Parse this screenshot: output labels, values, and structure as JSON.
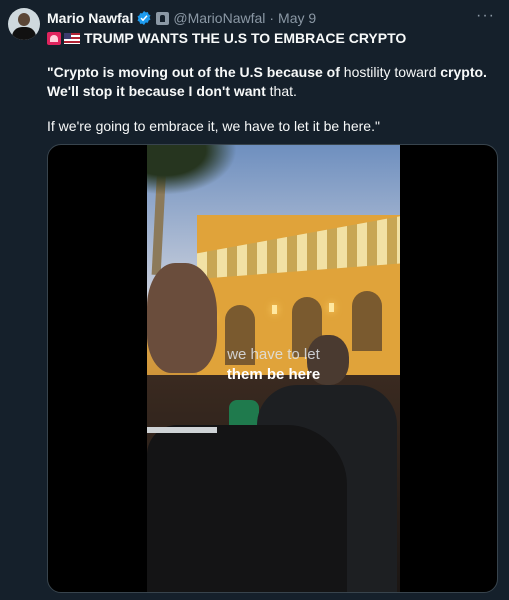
{
  "tweet": {
    "author_name": "Mario Nawfal",
    "handle": "@MarioNawfal",
    "separator": "·",
    "date": "May 9",
    "more_label": "···",
    "headline": "TRUMP WANTS THE U.S TO EMBRACE CRYPTO",
    "paragraph1": {
      "part1": "\"Crypto is moving out of the U.S because of",
      "part2": " hostility toward ",
      "part3": "crypto. We'll stop it because I don't want",
      "part4": " that."
    },
    "paragraph2": "If we're going to embrace it, we have to let it be here.\""
  },
  "video": {
    "caption_line1": "we have to let",
    "caption_line2": "them be here"
  },
  "colors": {
    "background": "#15202b",
    "text": "#f7f9f9",
    "muted": "#8b98a5",
    "verified": "#1d9bf0"
  },
  "icons": {
    "verified": "verified-badge-icon",
    "affiliate": "affiliate-badge-icon",
    "more": "more-options-icon"
  }
}
